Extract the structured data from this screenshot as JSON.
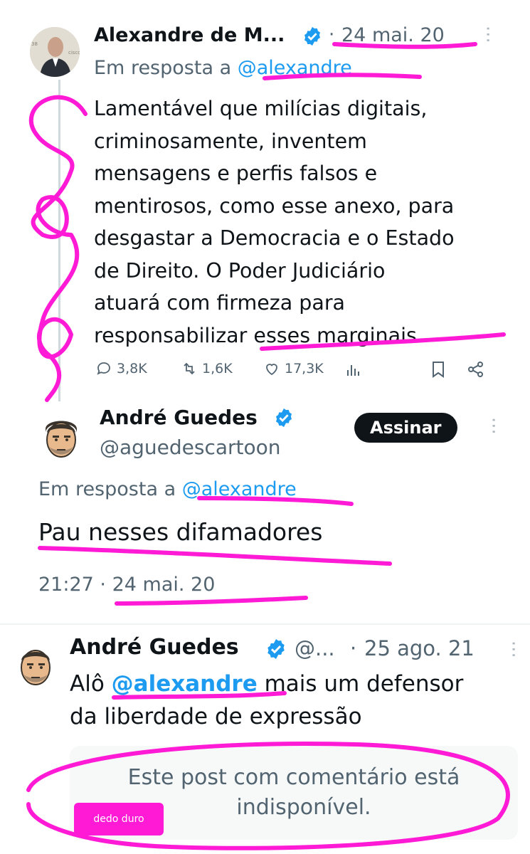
{
  "tweet1": {
    "author": "Alexandre de M...",
    "sep": "·",
    "date": "24 mai. 20",
    "reply_prefix": "Em resposta a",
    "reply_handle": "@alexandre",
    "text_lines": [
      "Lamentável que milícias digitais,",
      "criminosamente, inventem",
      "mensagens e perfis falsos e",
      "mentirosos, como esse anexo, para",
      "desgastar a Democracia e o Estado",
      "de Direito. O Poder Judiciário",
      "atuará com firmeza para",
      "responsabilizar esses marginais."
    ],
    "stats": {
      "replies": "3,8K",
      "retweets": "1,6K",
      "likes": "17,3K"
    }
  },
  "tweet2": {
    "author": "André Guedes",
    "handle": "@aguedescartoon",
    "subscribe": "Assinar",
    "reply_prefix": "Em resposta a",
    "reply_handle": "@alexandre",
    "text": "Pau nesses difamadores",
    "time": "21:27",
    "sep": "·",
    "date": "24 mai. 20"
  },
  "tweet3": {
    "author": "André Guedes",
    "handle": "@...",
    "sep": "·",
    "date": "25 ago. 21",
    "prefix": "Alô",
    "mention": "@alexandre",
    "rest": "mais um defensor",
    "line2": "da liberdade de expressão",
    "quoted_line1": "Este post com comentário está",
    "quoted_line2": "indisponível.",
    "tag": "dedo duro"
  },
  "colors": {
    "accent": "#1d9bf0",
    "annotation": "#ff1ad6",
    "text": "#0f1419",
    "muted": "#536471"
  },
  "icons": [
    "more-icon",
    "verified-icon",
    "reply-icon",
    "retweet-icon",
    "like-icon",
    "views-icon",
    "bookmark-icon",
    "share-icon"
  ]
}
